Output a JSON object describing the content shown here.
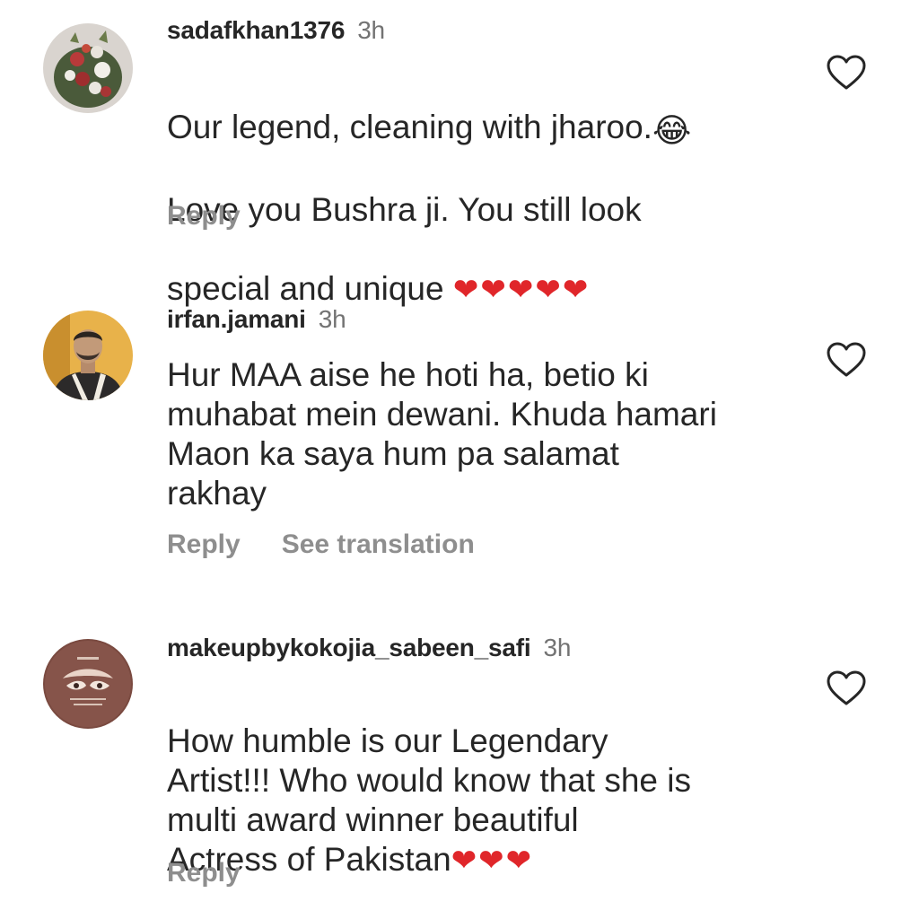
{
  "comments": [
    {
      "username": "sadafkhan1376",
      "time": "3h",
      "line1": "Our legend, cleaning with jharoo.",
      "line1_emoji": "😂",
      "line2": "Love you Bushra ji. You still look",
      "line3": "special and unique ",
      "hearts": "❤❤❤❤❤",
      "reply": "Reply",
      "avatar_icon": "flower-bouquet-avatar",
      "like_icon": "heart-outline-icon"
    },
    {
      "username": "irfan.jamani",
      "time": "3h",
      "text": "Hur MAA aise he hoti ha, betio ki\nmuhabat mein dewani. Khuda hamari\nMaon ka saya hum pa salamat\nrakhay",
      "reply": "Reply",
      "translate": "See translation",
      "avatar_icon": "person-photo-avatar",
      "like_icon": "heart-outline-icon"
    },
    {
      "username": "makeupbykokojia_sabeen_safi",
      "time": "3h",
      "text": "How humble is our Legendary\nArtist!!! Who would know that she is\nmulti award winner  beautiful\nActress of Pakistan",
      "hearts": "❤❤❤",
      "reply": "Reply",
      "avatar_icon": "makeup-logo-avatar",
      "like_icon": "heart-outline-icon"
    }
  ],
  "colors": {
    "text": "#262626",
    "muted": "#737373",
    "action": "#8e8e8e",
    "heart": "#e0262a"
  }
}
